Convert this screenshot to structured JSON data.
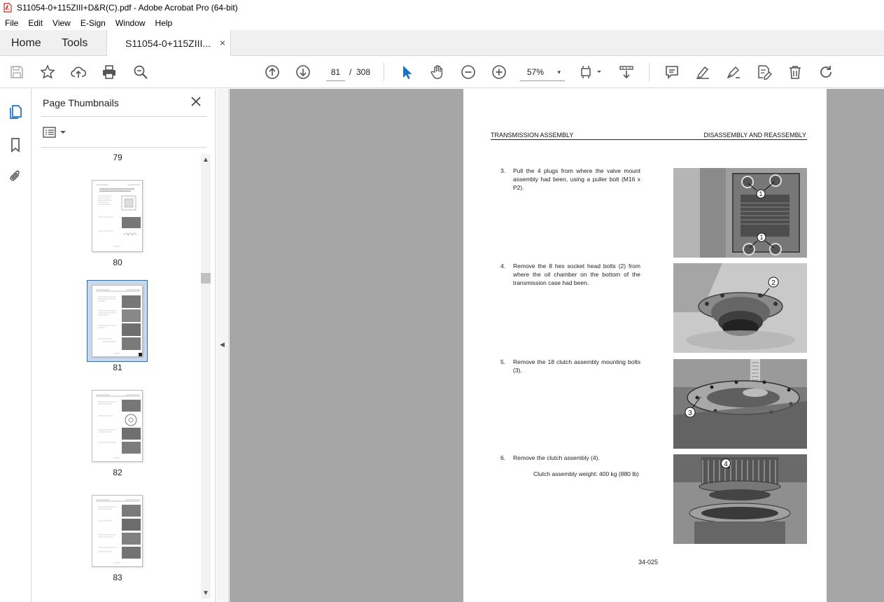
{
  "window": {
    "title": "S11054-0+115ZIII+D&R(C).pdf - Adobe Acrobat Pro (64-bit)",
    "accent_color": "#d5251f"
  },
  "menu": [
    "File",
    "Edit",
    "View",
    "E-Sign",
    "Window",
    "Help"
  ],
  "tabs": {
    "home": "Home",
    "tools": "Tools",
    "document": "S11054-0+115ZIII...",
    "close_glyph": "×"
  },
  "toolbar": {
    "current_page": "81",
    "page_separator": "/",
    "total_pages": "308",
    "zoom": "57%",
    "zoom_caret": "▾",
    "tool_color": "#1a73c9",
    "icon_color": "#555555"
  },
  "panel": {
    "title": "Page Thumbnails",
    "scroll_up": "▲",
    "scroll_down": "▼",
    "thumbnails": [
      {
        "label": "79"
      },
      {
        "label": "80"
      },
      {
        "label": "81"
      },
      {
        "label": "82"
      },
      {
        "label": "83"
      }
    ]
  },
  "collapse_arrow": "◀",
  "document": {
    "header_left": "TRANSMISSION ASSEMBLY",
    "header_right": "DISASSEMBLY AND REASSEMBLY",
    "steps": [
      {
        "num": "3.",
        "text": "Pull the 4 plugs from where the valve mount assembly had been, using a puller bolt (M16 x P2)."
      },
      {
        "num": "4.",
        "text": "Remove the 8 hex socket head bolts (2) from where the oil chamber on the bottom of the transmission case had been."
      },
      {
        "num": "5.",
        "text": "Remove the 18 clutch assembly mounting bolts (3)."
      },
      {
        "num": "6.",
        "text": "Remove the clutch assembly (4)."
      }
    ],
    "note": "Clutch assembly weight: 400 kg (880 lb)",
    "page_number": "34-025",
    "callouts": [
      "1",
      "1",
      "2",
      "3",
      "4"
    ]
  }
}
